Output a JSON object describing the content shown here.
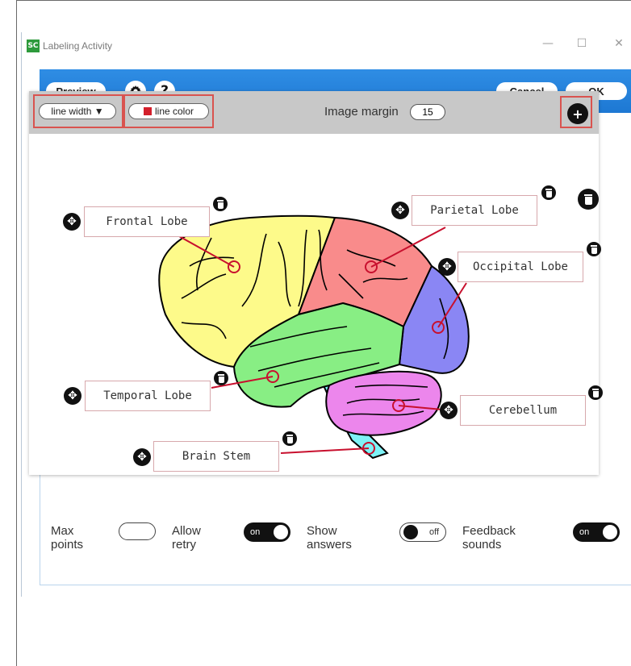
{
  "window": {
    "title": "Labeling Activity",
    "app_icon": "SC",
    "minimize": "—",
    "maximize": "☐",
    "close": "✕"
  },
  "top_bar": {
    "preview": "Preview",
    "settings_icon": "gear-icon",
    "help": "?",
    "cancel": "Cancel",
    "ok": "OK"
  },
  "toolbar": {
    "line_width": "line width ▼",
    "line_color": "line color",
    "line_color_value": "#d31f2b",
    "image_margin_label": "Image margin",
    "image_margin_value": "15",
    "add": "+"
  },
  "labels": [
    {
      "text": "Frontal Lobe"
    },
    {
      "text": "Parietal Lobe"
    },
    {
      "text": "Occipital Lobe"
    },
    {
      "text": "Temporal Lobe"
    },
    {
      "text": "Cerebellum"
    },
    {
      "text": "Brain Stem"
    }
  ],
  "regions": {
    "frontal": "#fdfa8a",
    "parietal": "#f98b8b",
    "occipital": "#8a86f4",
    "temporal": "#88ee84",
    "cerebellum": "#ec86ec",
    "brainstem": "#7ef2f6"
  },
  "footer": {
    "max_points_label": "Max points",
    "max_points_value": "",
    "allow_retry_label": "Allow retry",
    "allow_retry_state": "on",
    "show_answers_label": "Show answers",
    "show_answers_state": "off",
    "feedback_sounds_label": "Feedback sounds",
    "feedback_sounds_state": "on"
  }
}
